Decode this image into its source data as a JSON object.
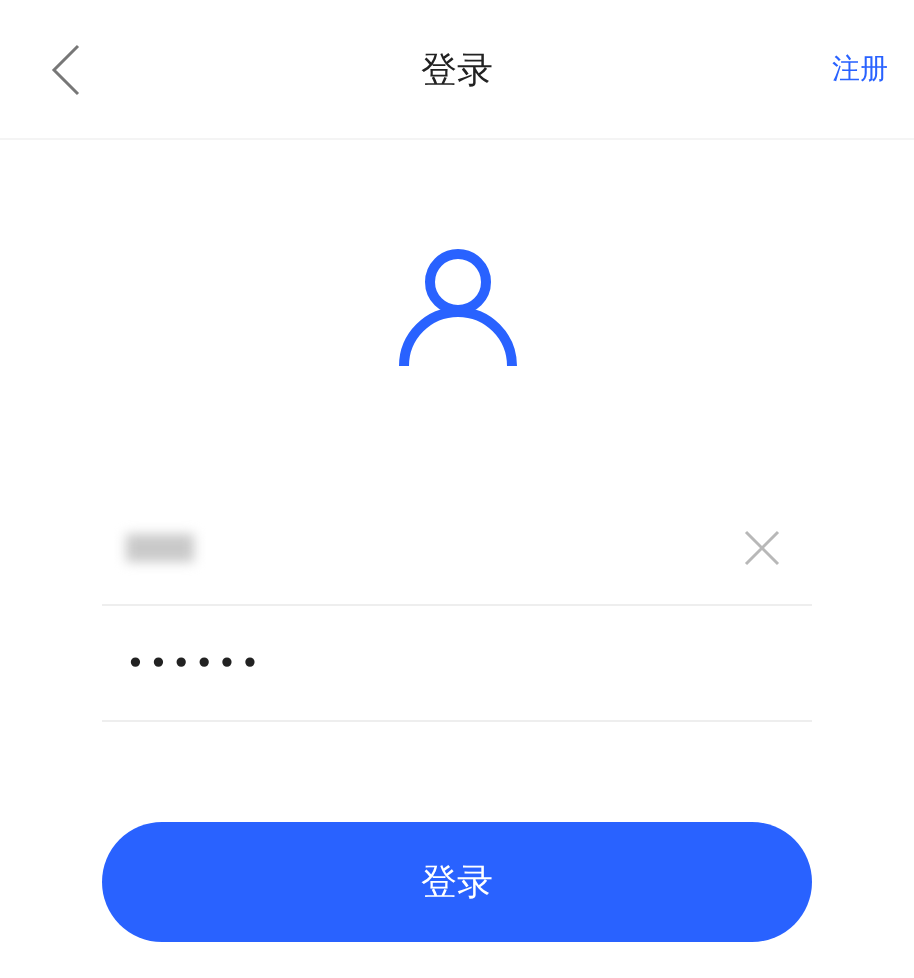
{
  "header": {
    "title": "登录",
    "action": "注册"
  },
  "username": {
    "redacted": true
  },
  "password": {
    "value": "••••••"
  },
  "submit": {
    "label": "登录"
  }
}
